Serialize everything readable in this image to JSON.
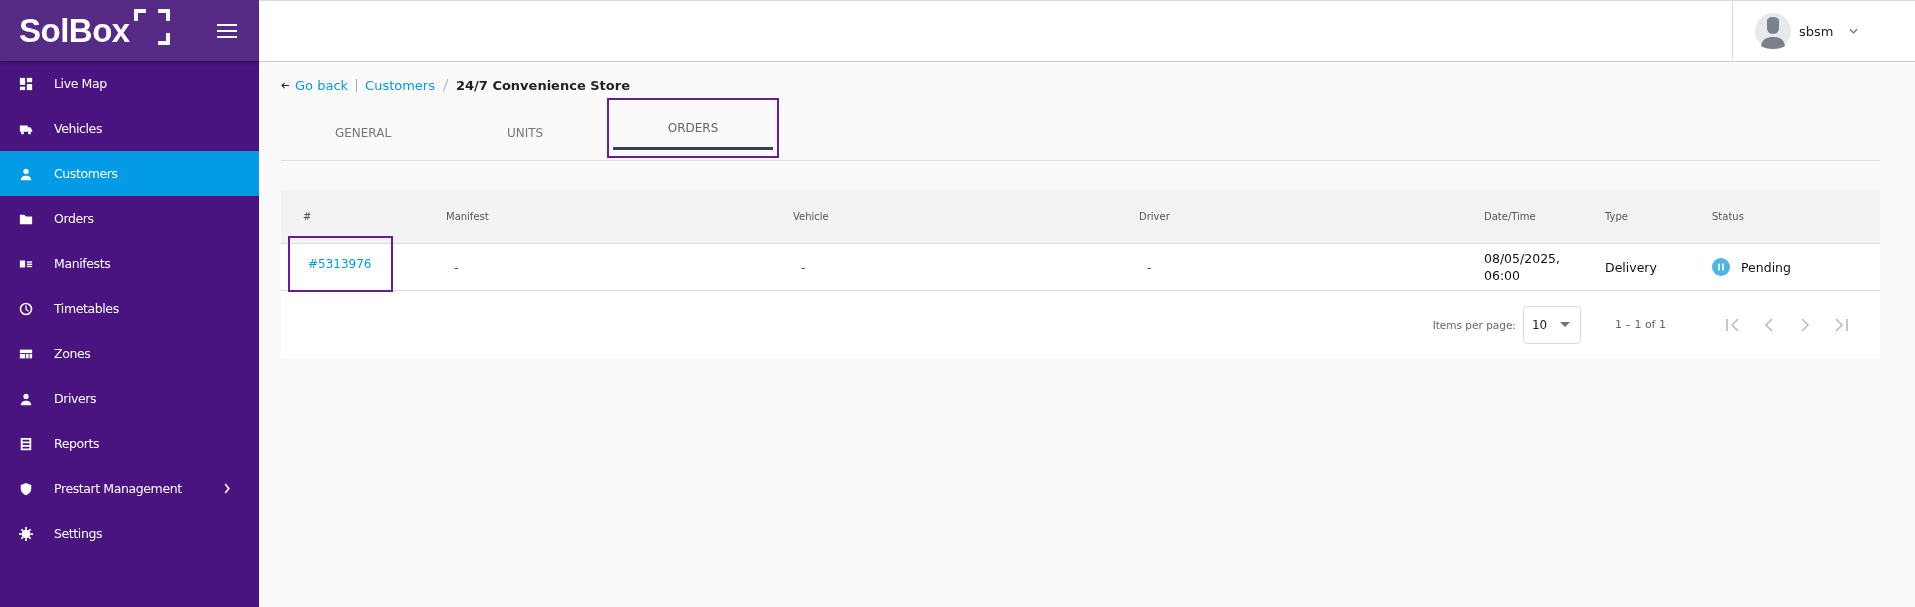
{
  "sidebar": {
    "logo": "SolBox",
    "items": [
      {
        "label": "Live Map",
        "selected": false
      },
      {
        "label": "Vehicles",
        "selected": false
      },
      {
        "label": "Customers",
        "selected": true
      },
      {
        "label": "Orders",
        "selected": false
      },
      {
        "label": "Manifests",
        "selected": false
      },
      {
        "label": "Timetables",
        "selected": false
      },
      {
        "label": "Zones",
        "selected": false
      },
      {
        "label": "Drivers",
        "selected": false
      },
      {
        "label": "Reports",
        "selected": false
      },
      {
        "label": "Prestart Management",
        "selected": false,
        "submenu": true
      },
      {
        "label": "Settings",
        "selected": false
      }
    ]
  },
  "user": {
    "name": "sbsm"
  },
  "breadcrumb": {
    "back": "Go back",
    "parent": "Customers",
    "current": "24/7 Convenience Store"
  },
  "tabs": [
    {
      "label": "GENERAL",
      "selected": false,
      "highlighted": false
    },
    {
      "label": "UNITS",
      "selected": false,
      "highlighted": false
    },
    {
      "label": "ORDERS",
      "selected": true,
      "highlighted": true
    }
  ],
  "table": {
    "columns": [
      "#",
      "Manifest",
      "Vehicle",
      "Driver",
      "Date/Time",
      "Type",
      "Status"
    ],
    "rows": [
      {
        "id": "#5313976",
        "id_highlighted": true,
        "manifest": "-",
        "vehicle": "-",
        "driver": "-",
        "datetime": "08/05/2025, 06:00",
        "type": "Delivery",
        "status": "Pending"
      }
    ]
  },
  "paginator": {
    "label": "Items per page:",
    "page_size": "10",
    "range": "1 – 1 of 1"
  }
}
